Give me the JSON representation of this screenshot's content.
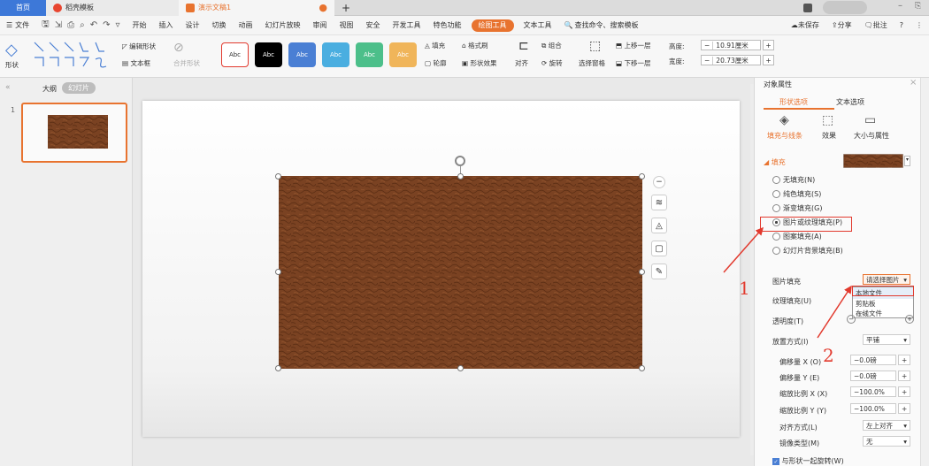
{
  "titlebar": {
    "tab_home": "首页",
    "tab_template": "稻壳模板",
    "tab_doc": "演示文稿1",
    "new_tab": "+"
  },
  "menu": {
    "file": "文件",
    "items": [
      "开始",
      "插入",
      "设计",
      "切换",
      "动画",
      "幻灯片放映",
      "审阅",
      "视图",
      "安全",
      "开发工具",
      "特色功能"
    ],
    "drawing_tools": "绘图工具",
    "text_tools": "文本工具",
    "search": "查找命令、搜索模板",
    "unsaved": "未保存",
    "share": "分享",
    "comment": "批注",
    "help": "?"
  },
  "ribbon": {
    "shape_label": "形状",
    "edit_shape": "编辑形状",
    "text_box": "文本框",
    "merge_shape": "合并形状",
    "style_swatches": [
      {
        "label": "Abc",
        "bg": "#ffffff",
        "fg": "#333",
        "border": "#e23a2e"
      },
      {
        "label": "Abc",
        "bg": "#000000",
        "fg": "#fff"
      },
      {
        "label": "Abc",
        "bg": "#4a7fd4",
        "fg": "#fff"
      },
      {
        "label": "Abc",
        "bg": "#4aaee0",
        "fg": "#fff"
      },
      {
        "label": "Abc",
        "bg": "#4cbf8a",
        "fg": "#fff"
      },
      {
        "label": "Abc",
        "bg": "#f0b55a",
        "fg": "#fff"
      }
    ],
    "fill": "填充",
    "format_brush": "格式刷",
    "outline": "轮廓",
    "shape_effect": "形状效果",
    "align": "对齐",
    "group": "组合",
    "rotate": "旋转",
    "select_pane": "选择窗格",
    "bring_forward": "上移一层",
    "send_backward": "下移一层",
    "height_label": "高度:",
    "height_value": "10.91厘米",
    "width_label": "宽度:",
    "width_value": "20.73厘米"
  },
  "leftpane": {
    "outline_tab": "大纲",
    "slides_tab": "幻灯片",
    "slide_number": "1"
  },
  "panel": {
    "title": "对象属性",
    "tab_shape": "形状选项",
    "tab_text": "文本选项",
    "sub_fill_line": "填充与线条",
    "sub_effect": "效果",
    "sub_size": "大小与属性",
    "section_fill": "填充",
    "fill_options": [
      "无填充(N)",
      "纯色填充(S)",
      "渐变填充(G)",
      "图片或纹理填充(P)",
      "图案填充(A)",
      "幻灯片背景填充(B)"
    ],
    "selected_fill_index": 3,
    "picture_fill_label": "图片填充",
    "picture_fill_btn": "请选择图片",
    "dropdown_items": [
      "本地文件",
      "剪贴板",
      "在线文件"
    ],
    "texture_fill_label": "纹理填充(U)",
    "transparency_label": "透明度(T)",
    "transparency_value": "0%",
    "placement_label": "放置方式(I)",
    "placement_value": "平铺",
    "offset_x_label": "偏移量 X (O)",
    "offset_x_value": "0.0磅",
    "offset_y_label": "偏移量 Y (E)",
    "offset_y_value": "0.0磅",
    "scale_x_label": "缩放比例 X (X)",
    "scale_x_value": "100.0%",
    "scale_y_label": "缩放比例 Y (Y)",
    "scale_y_value": "100.0%",
    "align_label": "对齐方式(L)",
    "align_value": "左上对齐",
    "mirror_label": "镜像类型(M)",
    "mirror_value": "无",
    "rotate_with_shape": "与形状一起旋转(W)"
  },
  "annotations": {
    "one": "1",
    "two": "2"
  },
  "colors": {
    "accent": "#e8732f",
    "annot_red": "#e23a2e",
    "texture": "#7a4222"
  }
}
